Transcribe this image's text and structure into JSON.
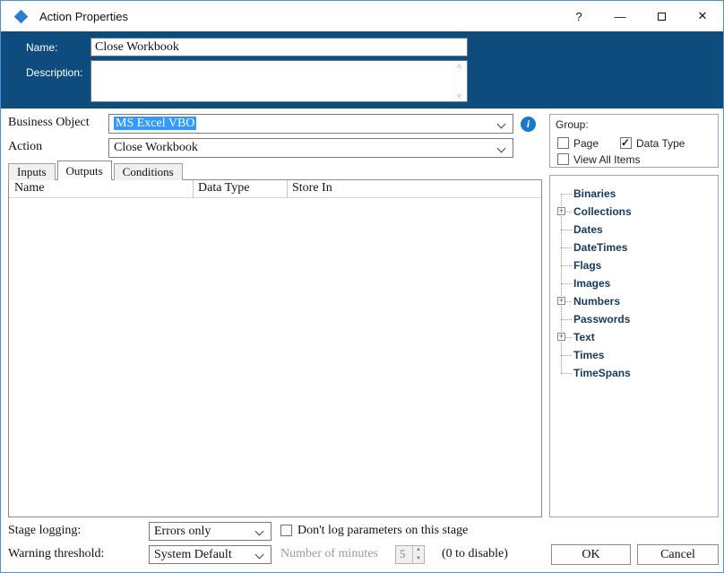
{
  "window": {
    "title": "Action Properties",
    "controls": {
      "help": "?",
      "minimize": "—",
      "close": "✕"
    }
  },
  "header": {
    "name_label": "Name:",
    "name_value": "Close Workbook",
    "description_label": "Description:",
    "description_value": ""
  },
  "selectors": {
    "business_object_label": "Business Object",
    "business_object_value": "MS Excel VBO",
    "action_label": "Action",
    "action_value": "Close Workbook"
  },
  "tabs": [
    {
      "label": "Inputs",
      "active": false
    },
    {
      "label": "Outputs",
      "active": true
    },
    {
      "label": "Conditions",
      "active": false
    }
  ],
  "table": {
    "columns": [
      "Name",
      "Data Type",
      "Store In"
    ],
    "rows": []
  },
  "group_panel": {
    "title": "Group:",
    "checkboxes": [
      {
        "label": "Page",
        "checked": false
      },
      {
        "label": "Data Type",
        "checked": true
      },
      {
        "label": "View All Items",
        "checked": false
      }
    ]
  },
  "tree": {
    "items": [
      {
        "label": "Binaries",
        "expandable": false
      },
      {
        "label": "Collections",
        "expandable": true
      },
      {
        "label": "Dates",
        "expandable": false
      },
      {
        "label": "DateTimes",
        "expandable": false
      },
      {
        "label": "Flags",
        "expandable": false
      },
      {
        "label": "Images",
        "expandable": false
      },
      {
        "label": "Numbers",
        "expandable": true
      },
      {
        "label": "Passwords",
        "expandable": false
      },
      {
        "label": "Text",
        "expandable": true
      },
      {
        "label": "Times",
        "expandable": false
      },
      {
        "label": "TimeSpans",
        "expandable": false
      }
    ]
  },
  "footer": {
    "stage_logging_label": "Stage logging:",
    "stage_logging_value": "Errors only",
    "dont_log_label": "Don't log parameters on this stage",
    "dont_log_checked": false,
    "warning_threshold_label": "Warning threshold:",
    "warning_threshold_value": "System Default",
    "number_of_minutes_label": "Number of minutes",
    "minutes_value": "5",
    "disable_hint": "(0 to disable)",
    "ok_label": "OK",
    "cancel_label": "Cancel"
  },
  "colors": {
    "header_band": "#0d4c7c",
    "selection_blue": "#3399ff",
    "info_icon_blue": "#1779c9",
    "tree_text": "#17395e",
    "window_border": "#4b93d2"
  }
}
